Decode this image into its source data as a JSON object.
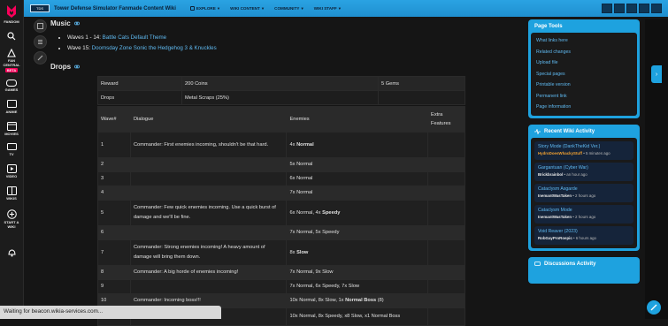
{
  "rail": {
    "items": [
      {
        "label": "FANDOM",
        "icon": "fandom-logo-icon"
      },
      {
        "label": "",
        "icon": "search-icon"
      },
      {
        "label": "FAN CENTRAL",
        "icon": "fan-central-icon",
        "badge": "BETA"
      },
      {
        "label": "GAMES",
        "icon": "games-icon"
      },
      {
        "label": "ANIME",
        "icon": "anime-icon"
      },
      {
        "label": "MOVIES",
        "icon": "movies-icon"
      },
      {
        "label": "TV",
        "icon": "tv-icon"
      },
      {
        "label": "VIDEO",
        "icon": "video-icon"
      },
      {
        "label": "WIKIS",
        "icon": "wikis-icon"
      },
      {
        "label": "START A WIKI",
        "icon": "start-wiki-icon"
      }
    ]
  },
  "header": {
    "wiki_title": "Tower Defense Simulator Fanmade Content Wiki",
    "nav": [
      "EXPLORE",
      "WIKI CONTENT",
      "COMMUNITY",
      "WIKI STAFF"
    ]
  },
  "music": {
    "heading": "Music",
    "items": [
      {
        "prefix": "Waves 1 - 14: ",
        "link": "Battle Cats Default Theme"
      },
      {
        "prefix": "Wave 15: ",
        "link": "Doomsday Zone Sonic the Hedgehog 3 & Knuckles"
      }
    ]
  },
  "drops": {
    "heading": "Drops",
    "summary": [
      [
        "Reward",
        "200 Coins",
        "5 Gems"
      ],
      [
        "Drops",
        "Metal Scraps (25%)",
        ""
      ]
    ],
    "columns": [
      "Wave#",
      "Dialogue",
      "Enemies",
      "Extra Features"
    ],
    "rows": [
      {
        "wave": "1",
        "dialogue": "Commander: First enemies incoming, shouldn't be that hard.",
        "enemies": "4x ",
        "bold": "Normal"
      },
      {
        "wave": "2",
        "dialogue": "",
        "enemies": "5x Normal",
        "bold": ""
      },
      {
        "wave": "3",
        "dialogue": "",
        "enemies": "6x Normal",
        "bold": ""
      },
      {
        "wave": "4",
        "dialogue": "",
        "enemies": "7x Normal",
        "bold": ""
      },
      {
        "wave": "5",
        "dialogue": "Commander: Few quick enemies incoming. Use a quick burst of damage and we'll be fine.",
        "enemies": "6x Normal, 4x ",
        "bold": "Speedy"
      },
      {
        "wave": "6",
        "dialogue": "",
        "enemies": "7x Normal, 5x Speedy",
        "bold": ""
      },
      {
        "wave": "7",
        "dialogue": "Commander: Strong enemies incoming! A heavy amount of damage will bring them down.",
        "enemies": "8x ",
        "bold": "Slow"
      },
      {
        "wave": "8",
        "dialogue": "Commander: A big horde of enemies incoming!",
        "enemies": "7x Normal, 9x Slow",
        "bold": ""
      },
      {
        "wave": "9",
        "dialogue": "",
        "enemies": "7x Normal, 6x Speedy, 7x Slow",
        "bold": ""
      },
      {
        "wave": "10",
        "dialogue": "Commander: Incoming boss!!!",
        "enemies": "10x Normal, 8x Slow, 1x ",
        "bold": "Normal Boss",
        "suffix": " (8)"
      },
      {
        "wave": "",
        "dialogue": "horde incoming.",
        "enemies": "10x Normal, 8x Speedy, x8 Slow, x1 Normal Boss",
        "bold": ""
      }
    ]
  },
  "page_tools": {
    "heading": "Page Tools",
    "links": [
      "What links here",
      "Related changes",
      "Upload file",
      "Special pages",
      "Printable version",
      "Permanent link",
      "Page information"
    ]
  },
  "recent_activity": {
    "heading": "Recent Wiki Activity",
    "items": [
      {
        "title": "Story Mode (DankTheKid Ver.)",
        "user": "HydroDoesWhackyStuff",
        "time": " • 5 minutes ago",
        "user_color": "orange"
      },
      {
        "title": "Gargantuan (Cyber War)",
        "user": "Brickbrainbol",
        "time": " • an hour ago",
        "user_color": "white"
      },
      {
        "title": "Cataclysm Asgarde",
        "user": "InemantWasTaken",
        "time": " • 2 hours ago",
        "user_color": "white"
      },
      {
        "title": "Cataclysm Mode",
        "user": "InemantWasTaken",
        "time": " • 2 hours ago",
        "user_color": "white"
      },
      {
        "title": "Void Reaver (2023)",
        "user": "RobGayProRoepic",
        "time": " • 6 hours ago",
        "user_color": "white"
      }
    ]
  },
  "discussions": {
    "heading": "Discussions Activity"
  },
  "status_bar": {
    "text": "Waiting for beacon.wikia-services.com..."
  },
  "colors": {
    "accent": "#1ea2df",
    "link": "#5fb9f0",
    "background": "#151515"
  }
}
